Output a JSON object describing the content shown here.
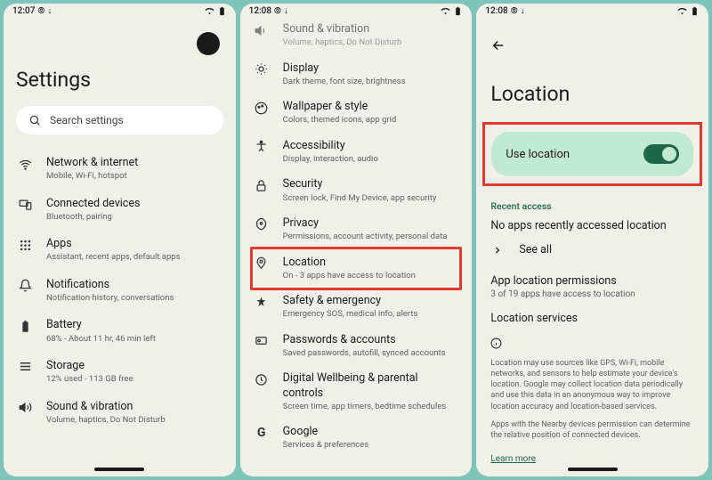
{
  "phone1": {
    "time": "12:07",
    "title": "Settings",
    "search_placeholder": "Search settings",
    "items": [
      {
        "title": "Network & internet",
        "sub": "Mobile, Wi-Fi, hotspot"
      },
      {
        "title": "Connected devices",
        "sub": "Bluetooth, pairing"
      },
      {
        "title": "Apps",
        "sub": "Assistant, recent apps, default apps"
      },
      {
        "title": "Notifications",
        "sub": "Notification history, conversations"
      },
      {
        "title": "Battery",
        "sub": "68% - About 11 hr, 46 min left"
      },
      {
        "title": "Storage",
        "sub": "12% used - 113 GB free"
      },
      {
        "title": "Sound & vibration",
        "sub": "Volume, haptics, Do Not Disturb"
      }
    ]
  },
  "phone2": {
    "time": "12:08",
    "items": [
      {
        "title": "Sound & vibration",
        "sub": "Volume, haptics, Do Not Disturb"
      },
      {
        "title": "Display",
        "sub": "Dark theme, font size, brightness"
      },
      {
        "title": "Wallpaper & style",
        "sub": "Colors, themed icons, app grid"
      },
      {
        "title": "Accessibility",
        "sub": "Display, interaction, audio"
      },
      {
        "title": "Security",
        "sub": "Screen lock, Find My Device, app security"
      },
      {
        "title": "Privacy",
        "sub": "Permissions, account activity, personal data"
      },
      {
        "title": "Location",
        "sub": "On - 3 apps have access to location"
      },
      {
        "title": "Safety & emergency",
        "sub": "Emergency SOS, medical info, alerts"
      },
      {
        "title": "Passwords & accounts",
        "sub": "Saved passwords, autofill, synced accounts"
      },
      {
        "title": "Digital Wellbeing & parental controls",
        "sub": "Screen time, app timers, bedtime schedules"
      },
      {
        "title": "Google",
        "sub": "Services & preferences"
      }
    ]
  },
  "phone3": {
    "time": "12:08",
    "title": "Location",
    "use_location": "Use location",
    "recent_access": "Recent access",
    "no_apps": "No apps recently accessed location",
    "see_all": "See all",
    "app_loc_perm": "App location permissions",
    "app_loc_sub": "3 of 19 apps have access to location",
    "loc_services": "Location services",
    "info1": "Location may use sources like GPS, Wi-Fi, mobile networks, and sensors to help estimate your device's location. Google may collect location data periodically and use this data in an anonymous way to improve location accuracy and location-based services.",
    "info2": "Apps with the Nearby devices permission can determine the relative position of connected devices.",
    "learn_more": "Learn more"
  }
}
